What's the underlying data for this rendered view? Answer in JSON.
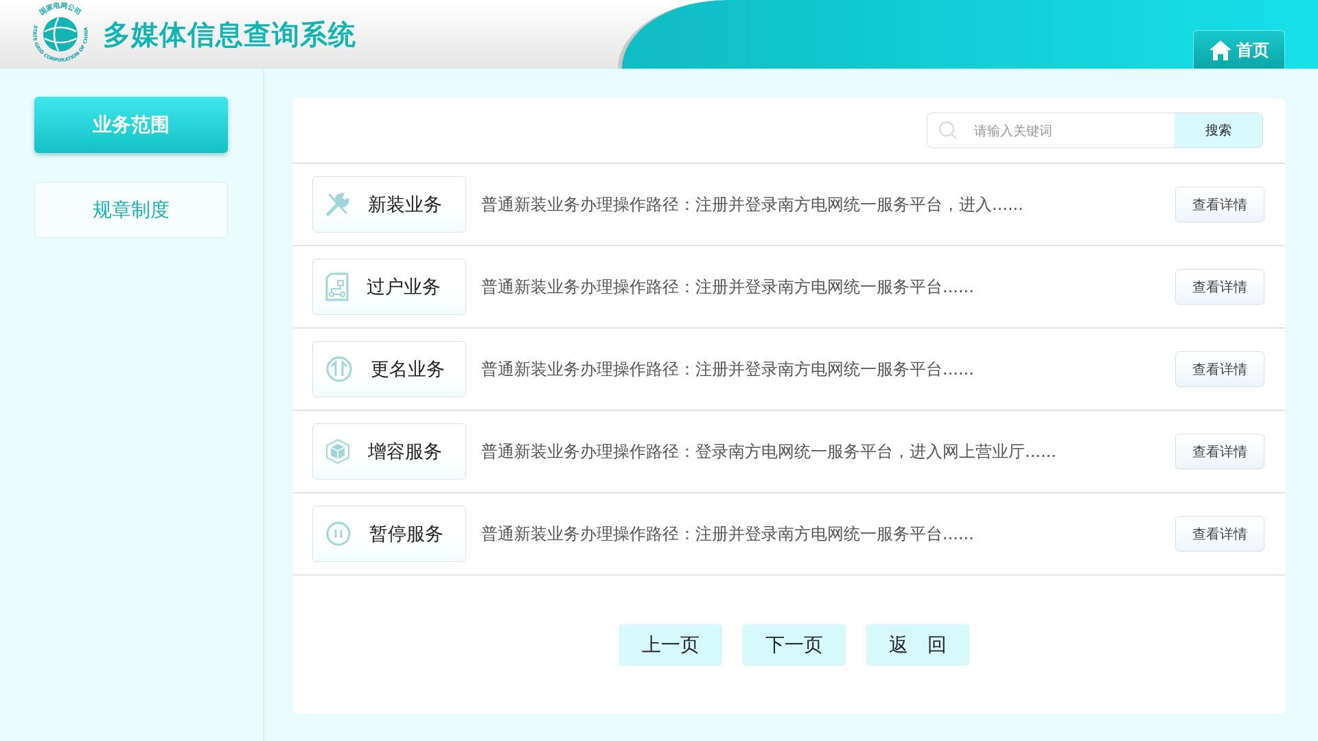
{
  "header": {
    "logo_text_cn": "国家电网公司",
    "logo_text_en": "STATE GRID CORPORATION OF CHINA",
    "title": "多媒体信息查询系统",
    "home_button": "首页"
  },
  "sidebar": {
    "items": [
      {
        "label": "业务范围",
        "selected": true
      },
      {
        "label": "规章制度",
        "selected": false
      }
    ]
  },
  "search": {
    "placeholder": "请输入关键词",
    "button": "搜索"
  },
  "services": [
    {
      "kind": "tools",
      "name": "新装业务",
      "description": "普通新装业务办理操作路径：注册并登录南方电网统一服务平台，进入......",
      "button": "查看详情"
    },
    {
      "kind": "document",
      "name": "过户业务",
      "description": "普通新装业务办理操作路径：注册并登录南方电网统一服务平台......",
      "button": "查看详情"
    },
    {
      "kind": "arrows",
      "name": "更名业务",
      "description": "普通新装业务办理操作路径：注册并登录南方电网统一服务平台......",
      "button": "查看详情"
    },
    {
      "kind": "cube",
      "name": "增容服务",
      "description": "普通新装业务办理操作路径：登录南方电网统一服务平台，进入网上营业厅......",
      "button": "查看详情"
    },
    {
      "kind": "pause",
      "name": "暂停服务",
      "description": "普通新装业务办理操作路径：注册并登录南方电网统一服务平台......",
      "button": "查看详情"
    }
  ],
  "pagination": [
    "上一页",
    "下一页",
    "返　回"
  ]
}
